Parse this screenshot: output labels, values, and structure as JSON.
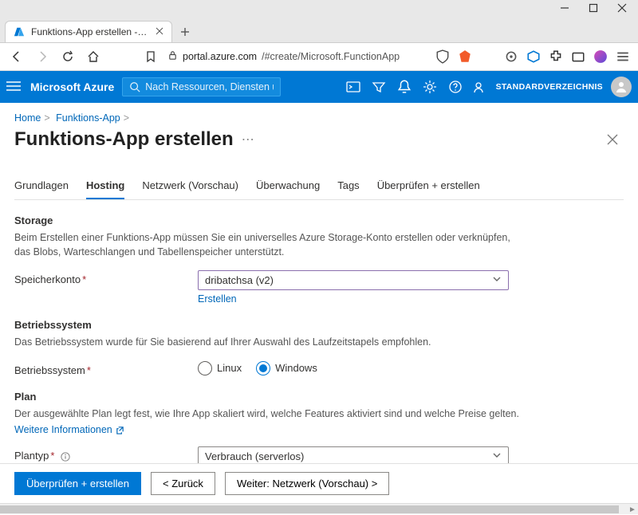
{
  "browser": {
    "tab_title": "Funktions-App erstellen - Microsoft",
    "url_host": "portal.azure.com",
    "url_path": "/#create/Microsoft.FunctionApp"
  },
  "header": {
    "brand": "Microsoft Azure",
    "search_placeholder": "Nach Ressourcen, Diensten und Dokumenten suchen (G+/)",
    "tenant": "STANDARDVERZEICHNIS"
  },
  "breadcrumbs": {
    "home": "Home",
    "parent": "Funktions-App"
  },
  "page": {
    "title": "Funktions-App erstellen"
  },
  "tabs": {
    "basics": "Grundlagen",
    "hosting": "Hosting",
    "network": "Netzwerk (Vorschau)",
    "monitor": "Überwachung",
    "tags": "Tags",
    "review": "Überprüfen + erstellen"
  },
  "storage": {
    "heading": "Storage",
    "desc": "Beim Erstellen einer Funktions-App müssen Sie ein universelles Azure Storage-Konto erstellen oder verknüpfen, das Blobs, Warteschlangen und Tabellenspeicher unterstützt.",
    "label": "Speicherkonto",
    "value": "dribatchsa (v2)",
    "create_link": "Erstellen"
  },
  "os": {
    "heading": "Betriebssystem",
    "desc": "Das Betriebssystem wurde für Sie basierend auf Ihrer Auswahl des Laufzeitstapels empfohlen.",
    "label": "Betriebssystem",
    "opt_linux": "Linux",
    "opt_windows": "Windows",
    "selected": "Windows"
  },
  "plan": {
    "heading": "Plan",
    "desc": "Der ausgewählte Plan legt fest, wie Ihre App skaliert wird, welche Features aktiviert sind und welche Preise gelten.",
    "more_info": "Weitere Informationen",
    "label": "Plantyp",
    "value": "Verbrauch (serverlos)"
  },
  "footer": {
    "review": "Überprüfen + erstellen",
    "back": "< Zurück",
    "next": "Weiter: Netzwerk (Vorschau) >"
  }
}
